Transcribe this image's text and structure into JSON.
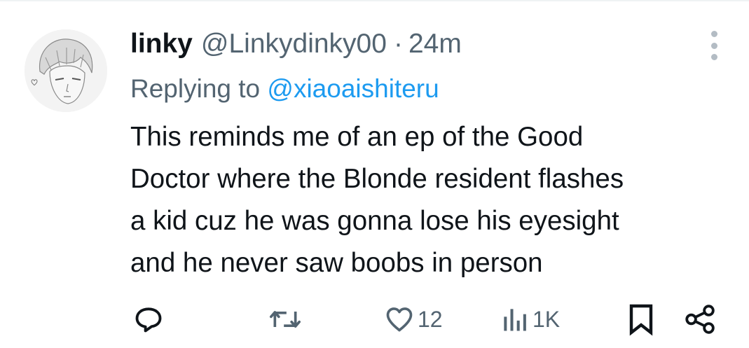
{
  "tweet": {
    "display_name": "linky",
    "handle": "@Linkydinky00",
    "separator": "·",
    "time": "24m",
    "replying_prefix": "Replying to ",
    "replying_to": "@xiaoaishiteru",
    "body_lines": [
      "This reminds me of an ep of the Good",
      "Doctor where the Blonde resident flashes",
      "a kid cuz he was gonna lose his eyesight",
      "and he never saw boobs in person"
    ]
  },
  "actions": {
    "reply_icon": "reply-icon",
    "retweet_icon": "retweet-icon",
    "like_icon": "heart-icon",
    "like_count": "12",
    "views_icon": "views-icon",
    "views_count": "1K",
    "bookmark_icon": "bookmark-icon",
    "share_icon": "share-icon"
  },
  "colors": {
    "text_primary": "#0f1419",
    "text_secondary": "#536471",
    "link": "#1d9bf0",
    "more_dots": "#b3bcc4"
  }
}
